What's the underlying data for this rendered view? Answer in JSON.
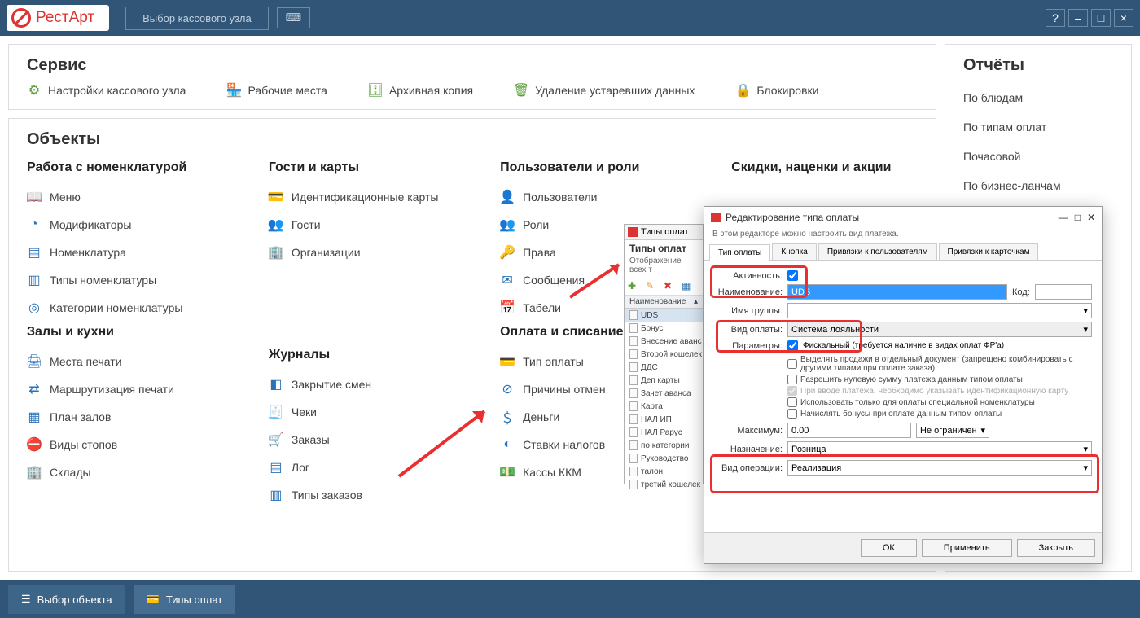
{
  "titlebar": {
    "logo": "РестАрт",
    "select_register": "Выбор кассового узла"
  },
  "service": {
    "heading": "Сервис",
    "items": {
      "settings": "Настройки кассового узла",
      "workplaces": "Рабочие места",
      "archive": "Архивная копия",
      "cleanup": "Удаление устаревших данных",
      "locks": "Блокировки"
    }
  },
  "objects": {
    "heading": "Объекты",
    "col1": {
      "h1": "Работа с номенклатурой",
      "menu": "Меню",
      "modifiers": "Модификаторы",
      "nomenclature": "Номенклатура",
      "nom_types": "Типы номенклатуры",
      "nom_categories": "Категории номенклатуры",
      "h2": "Залы и кухни",
      "print_places": "Места печати",
      "print_routing": "Маршрутизация печати",
      "hall_plan": "План залов",
      "stop_types": "Виды стопов",
      "warehouses": "Склады"
    },
    "col2": {
      "h1": "Гости и карты",
      "id_cards": "Идентификационные карты",
      "guests": "Гости",
      "orgs": "Организации",
      "h2": "Журналы",
      "shift_close": "Закрытие смен",
      "checks": "Чеки",
      "orders": "Заказы",
      "log": "Лог",
      "order_types": "Типы заказов"
    },
    "col3": {
      "h1": "Пользователи и роли",
      "users": "Пользователи",
      "roles": "Роли",
      "rights": "Права",
      "messages": "Сообщения",
      "timesheets": "Табели",
      "h2": "Оплата и списание",
      "payment_type": "Тип оплаты",
      "cancel_reasons": "Причины отмен",
      "money": "Деньги",
      "tax_rates": "Ставки налогов",
      "kkm": "Кассы ККМ"
    },
    "col4": {
      "h1": "Скидки, наценки и акции"
    }
  },
  "reports": {
    "heading": "Отчёты",
    "by_dishes": "По блюдам",
    "by_payment_types": "По типам оплат",
    "hourly": "Почасовой",
    "by_business": "По бизнес-ланчам"
  },
  "list_panel": {
    "window_title": "Типы оплат",
    "title": "Типы оплат",
    "subtitle": "Отображение всех т",
    "col_header": "Наименование",
    "items": [
      "UDS",
      "Бонус",
      "Внесение аванс н",
      "Второй кошелек",
      "ДДС",
      "Деп карты",
      "Зачет аванса",
      "Карта",
      "НАЛ ИП",
      "НАЛ Рарус",
      "по категории",
      "Руководство",
      "талон",
      "третий кошелек"
    ]
  },
  "dialog": {
    "title": "Редактирование типа оплаты",
    "subtitle": "В этом редакторе можно настроить вид платежа.",
    "tabs": [
      "Тип оплаты",
      "Кнопка",
      "Привязки к пользователям",
      "Привязки к карточкам"
    ],
    "labels": {
      "activity": "Активность:",
      "name": "Наименование:",
      "code": "Код:",
      "group": "Имя группы:",
      "payment_kind": "Вид оплаты:",
      "params": "Параметры:",
      "maximum": "Максимум:",
      "purpose": "Назначение:",
      "operation_kind": "Вид операции:"
    },
    "values": {
      "name": "UDS",
      "payment_kind": "Система лояльности",
      "fiscal": "Фискальный (требуется наличие в видах оплат ФР'а)",
      "separate_doc": "Выделять продажи в отдельный документ (запрещено комбинировать с другими типами при оплате заказа)",
      "allow_zero": "Разрешить нулевую сумму платежа данным типом оплаты",
      "need_card": "При вводе платежа, необходимо указывать идентификационную карту",
      "special_only": "Использовать только для оплаты специальной номенклатуры",
      "accrue_bonus": "Начислять бонусы при оплате данным типом оплаты",
      "maximum": "0.00",
      "max_limit": "Не ограничен",
      "purpose": "Розница",
      "operation_kind": "Реализация"
    },
    "buttons": {
      "ok": "ОК",
      "apply": "Применить",
      "close": "Закрыть"
    }
  },
  "bottombar": {
    "select_object": "Выбор объекта",
    "payment_types": "Типы оплат"
  }
}
